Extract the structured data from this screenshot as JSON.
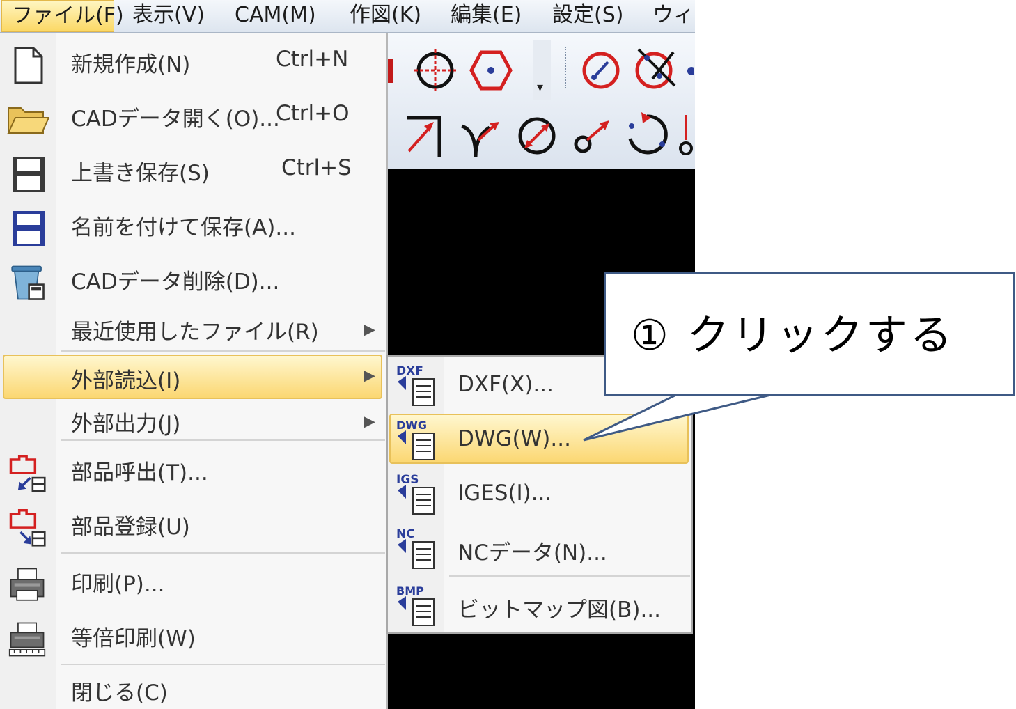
{
  "menubar": {
    "items": [
      "ファイル(F)",
      "表示(V)",
      "CAM(M)",
      "作図(K)",
      "編集(E)",
      "設定(S)",
      "ウィン"
    ]
  },
  "file_menu": {
    "items": [
      {
        "label": "新規作成(N)",
        "shortcut": "Ctrl+N",
        "icon": "new-document-icon"
      },
      {
        "label": "CADデータ開く(O)...",
        "shortcut": "Ctrl+O",
        "icon": "open-folder-icon"
      },
      {
        "label": "上書き保存(S)",
        "shortcut": "Ctrl+S",
        "icon": "save-icon"
      },
      {
        "label": "名前を付けて保存(A)...",
        "shortcut": "",
        "icon": "save-as-icon"
      },
      {
        "label": "CADデータ削除(D)...",
        "shortcut": "",
        "icon": "delete-data-icon"
      },
      {
        "label": "最近使用したファイル(R)",
        "shortcut": "",
        "icon": "",
        "submenu": true
      },
      {
        "label": "外部読込(I)",
        "shortcut": "",
        "icon": "",
        "submenu": true,
        "highlighted": true
      },
      {
        "label": "外部出力(J)",
        "shortcut": "",
        "icon": "",
        "submenu": true
      },
      {
        "label": "部品呼出(T)...",
        "shortcut": "",
        "icon": "parts-call-icon"
      },
      {
        "label": "部品登録(U)",
        "shortcut": "",
        "icon": "parts-register-icon"
      },
      {
        "label": "印刷(P)...",
        "shortcut": "",
        "icon": "print-icon"
      },
      {
        "label": "等倍印刷(W)",
        "shortcut": "",
        "icon": "actual-size-print-icon"
      },
      {
        "label": "閉じる(C)",
        "shortcut": "",
        "icon": ""
      }
    ]
  },
  "import_submenu": {
    "items": [
      {
        "label": "DXF(X)...",
        "badge": "DXF"
      },
      {
        "label": "DWG(W)...",
        "badge": "DWG",
        "highlighted": true
      },
      {
        "label": "IGES(I)...",
        "badge": "IGS"
      },
      {
        "label": "NCデータ(N)...",
        "badge": "NC"
      },
      {
        "label": "ビットマップ図(B)...",
        "badge": "BMP"
      }
    ]
  },
  "callout": {
    "text": "① クリックする"
  },
  "colors": {
    "highlight": "#fbd772",
    "callout_border": "#3f5a85",
    "icon_red": "#d42020",
    "icon_blue": "#2a3d9a"
  }
}
